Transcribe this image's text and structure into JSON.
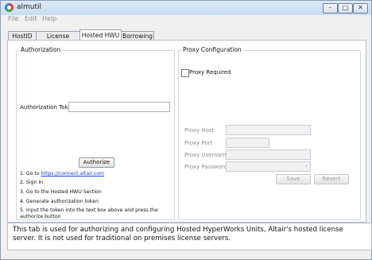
{
  "window": {
    "title": "almutil",
    "minimize_icon": "minimize-icon",
    "maximize_icon": "maximize-icon",
    "close_icon": "close-icon"
  },
  "menu": [
    "File",
    "Edit",
    "Help"
  ],
  "tabs": [
    "HostID",
    "License Usage",
    "Hosted HWU",
    "Borrowing"
  ],
  "authorization": {
    "legend": "Authorization",
    "token_label": "Authorization Token",
    "token_value": "",
    "authorize_label": "Authorize",
    "steps": {
      "s1_prefix": "1. Go to ",
      "s1_link": "https://connect.altair.com",
      "s2": "2. Sign In",
      "s3": "3. Go to the Hosted HWU Section",
      "s4": "4. Generate authorization token",
      "s5a": "5. Input the token into the text box above and press the",
      "s5b": "authorize button"
    }
  },
  "proxy": {
    "legend": "Proxy Configuration",
    "required_label": "Proxy Required",
    "required_checked": false,
    "host_label": "Proxy Host",
    "port_label": "Proxy Port",
    "username_label": "Proxy Username",
    "password_label": "Proxy Password",
    "save_label": "Save",
    "revert_label": "Revert"
  },
  "info_text": "This tab is used for authorizing and configuring Hosted HyperWorks Units, Altair's hosted license server.  It is not used for traditional on premises license servers."
}
